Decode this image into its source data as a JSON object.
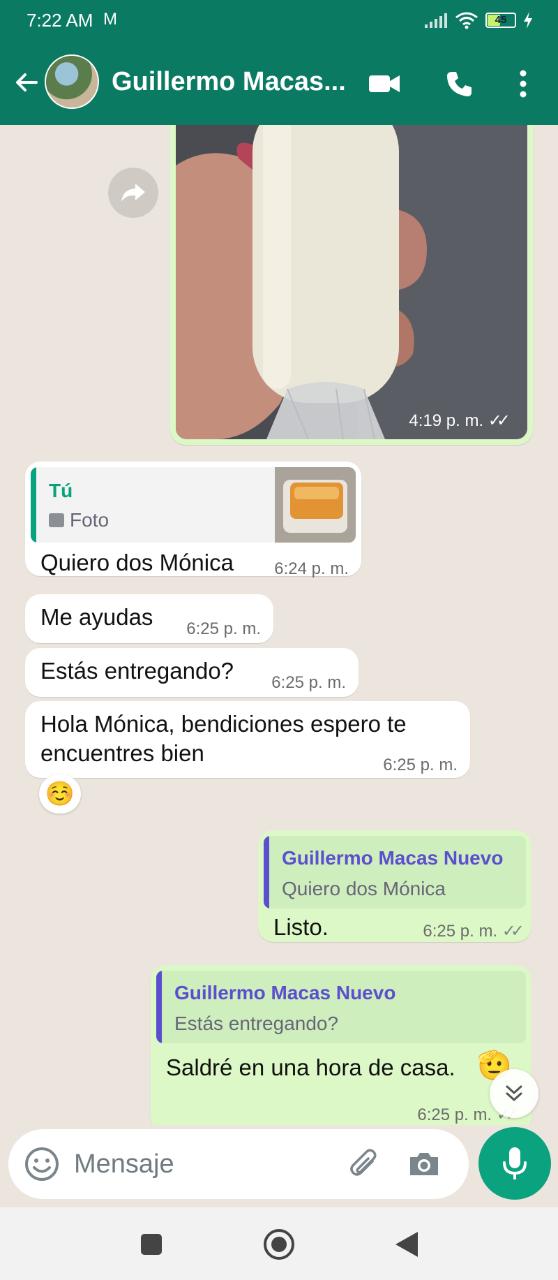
{
  "status_bar": {
    "time": "7:22 AM",
    "mail_icon": "M",
    "battery": "45"
  },
  "header": {
    "contact_name": "Guillermo Macas...",
    "icons": [
      "back-arrow-icon",
      "video-call-icon",
      "voice-call-icon",
      "more-options-icon"
    ]
  },
  "messages": {
    "image_message": {
      "time": "4:19 p. m.",
      "status": "read"
    },
    "reply_in": {
      "quote_author": "Tú",
      "quote_type": "Foto",
      "text": "Quiero dos Mónica",
      "time": "6:24 p. m."
    },
    "msg2": {
      "text": "Me ayudas",
      "time": "6:25 p. m."
    },
    "msg3": {
      "text": "Estás entregando?",
      "time": "6:25 p. m."
    },
    "msg4": {
      "text_line1": "Hola Mónica, bendiciones espero te",
      "text_line2": "encuentres bien",
      "time": "6:25 p. m.",
      "reaction": "☺️"
    },
    "out1": {
      "quote_author": "Guillermo Macas Nuevo",
      "quote_text": "Quiero dos Mónica",
      "text": "Listo.",
      "time": "6:25 p. m."
    },
    "out2": {
      "quote_author": "Guillermo Macas Nuevo",
      "quote_text": "Estás entregando?",
      "text": "Saldré en una hora de casa.",
      "emoji": "🫡",
      "time": "6:25 p. m."
    }
  },
  "composer": {
    "placeholder": "Mensaje"
  },
  "colors": {
    "header": "#0b7a63",
    "outgoing_bubble": "#dcf8c6",
    "incoming_bubble": "#ffffff",
    "accent_green": "#0ba27f",
    "quote_self": "#07a37e",
    "quote_other": "#5b4fcf"
  }
}
